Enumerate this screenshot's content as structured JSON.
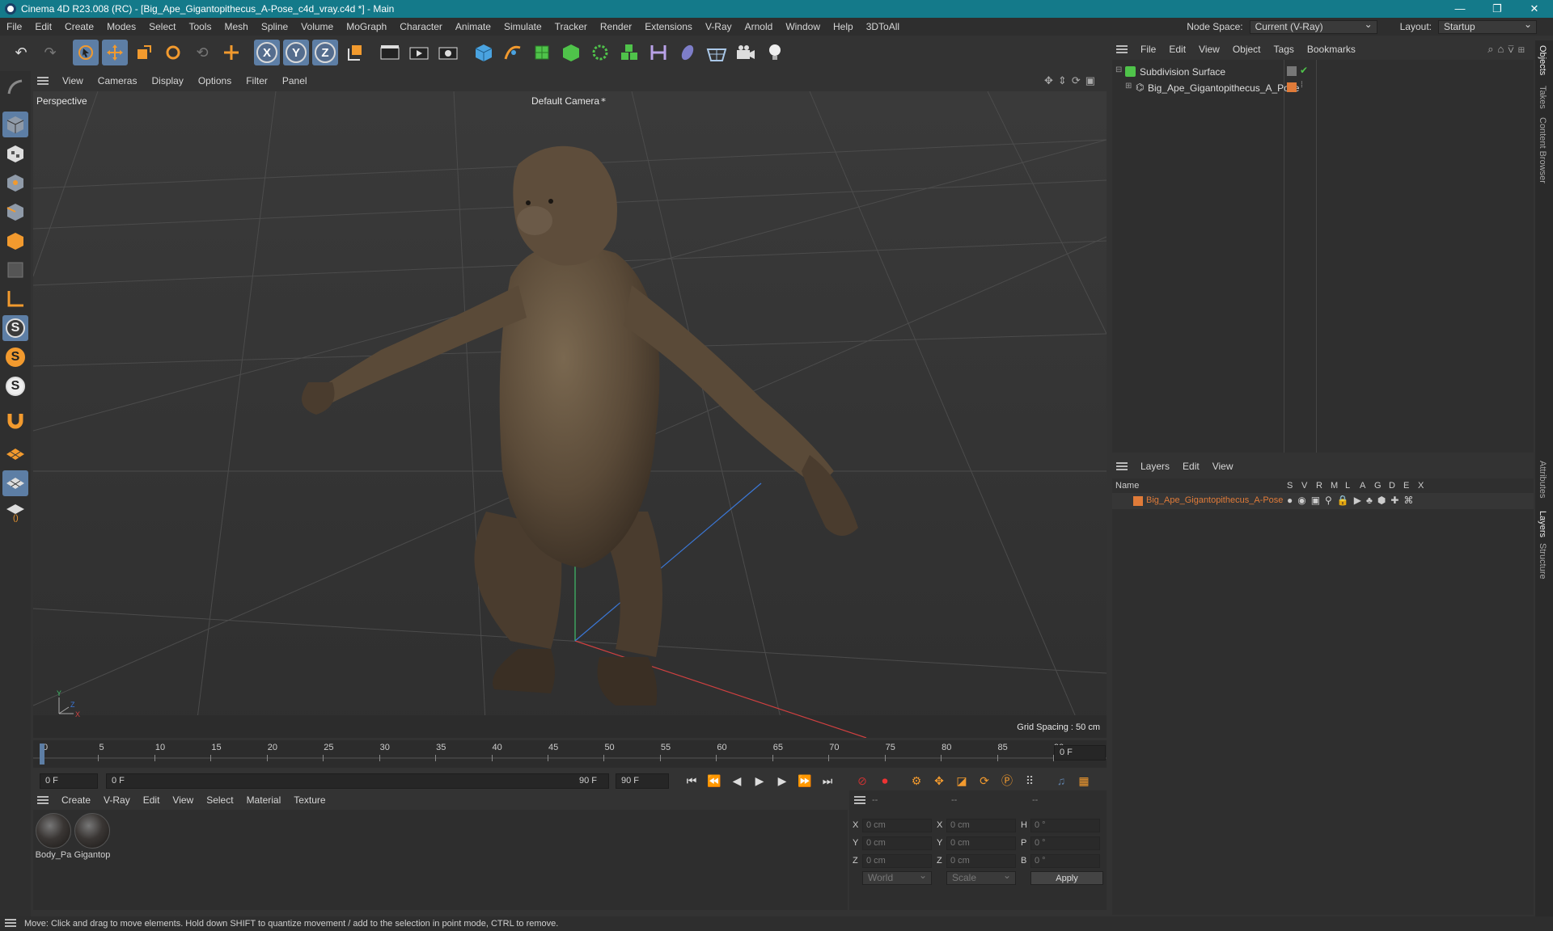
{
  "window": {
    "title": "Cinema 4D R23.008 (RC) - [Big_Ape_Gigantopithecus_A-Pose_c4d_vray.c4d *] - Main",
    "controls": [
      "—",
      "❐",
      "✕"
    ]
  },
  "menubar": {
    "items": [
      "File",
      "Edit",
      "Create",
      "Modes",
      "Select",
      "Tools",
      "Mesh",
      "Spline",
      "Volume",
      "MoGraph",
      "Character",
      "Animate",
      "Simulate",
      "Tracker",
      "Render",
      "Extensions",
      "V-Ray",
      "Arnold",
      "Window",
      "Help",
      "3DToAll"
    ],
    "node_space_label": "Node Space:",
    "node_space_value": "Current (V-Ray)",
    "layout_label": "Layout:",
    "layout_value": "Startup"
  },
  "viewport": {
    "menu": [
      "View",
      "Cameras",
      "Display",
      "Options",
      "Filter",
      "Panel"
    ],
    "projection": "Perspective",
    "camera": "Default Camera",
    "grid_spacing": "Grid Spacing : 50 cm",
    "axis_x": "X",
    "axis_y": "Y",
    "axis_z": "Z"
  },
  "timeline": {
    "ticks": [
      "0",
      "5",
      "10",
      "15",
      "20",
      "25",
      "30",
      "35",
      "40",
      "45",
      "50",
      "55",
      "60",
      "65",
      "70",
      "75",
      "80",
      "85",
      "90"
    ],
    "current_frame": "0 F"
  },
  "transport": {
    "start": "0 F",
    "range_start": "0 F",
    "range_end": "90 F",
    "end": "90 F"
  },
  "material_manager": {
    "menu": [
      "Create",
      "V-Ray",
      "Edit",
      "View",
      "Select",
      "Material",
      "Texture"
    ],
    "materials": [
      "Body_Pa",
      "Gigantop"
    ]
  },
  "coordinates": {
    "headers": [
      "--",
      "--",
      "--"
    ],
    "rows": [
      {
        "a": "X",
        "v1": "0 cm",
        "b": "X",
        "v2": "0 cm",
        "c": "H",
        "v3": "0 °"
      },
      {
        "a": "Y",
        "v1": "0 cm",
        "b": "Y",
        "v2": "0 cm",
        "c": "P",
        "v3": "0 °"
      },
      {
        "a": "Z",
        "v1": "0 cm",
        "b": "Z",
        "v2": "0 cm",
        "c": "B",
        "v3": "0 °"
      }
    ],
    "mode": "World",
    "type": "Scale",
    "apply": "Apply"
  },
  "objects": {
    "menu": [
      "File",
      "Edit",
      "View",
      "Object",
      "Tags",
      "Bookmarks"
    ],
    "items": [
      "Subdivision Surface",
      "Big_Ape_Gigantopithecus_A_Pose"
    ]
  },
  "layers": {
    "menu": [
      "Layers",
      "Edit",
      "View"
    ],
    "name_header": "Name",
    "columns": [
      "S",
      "V",
      "R",
      "M",
      "L",
      "A",
      "G",
      "D",
      "E",
      "X"
    ],
    "items": [
      "Big_Ape_Gigantopithecus_A-Pose"
    ]
  },
  "side_tabs": [
    "Objects",
    "Takes",
    "Content Browser",
    "Attributes",
    "Layers",
    "Structure"
  ],
  "status": "Move: Click and drag to move elements. Hold down SHIFT to quantize movement / add to the selection in point mode, CTRL to remove.",
  "colors": {
    "title_bar": "#147a8a",
    "accent": "#5d7ea5",
    "layer_orange": "#e07b39"
  }
}
